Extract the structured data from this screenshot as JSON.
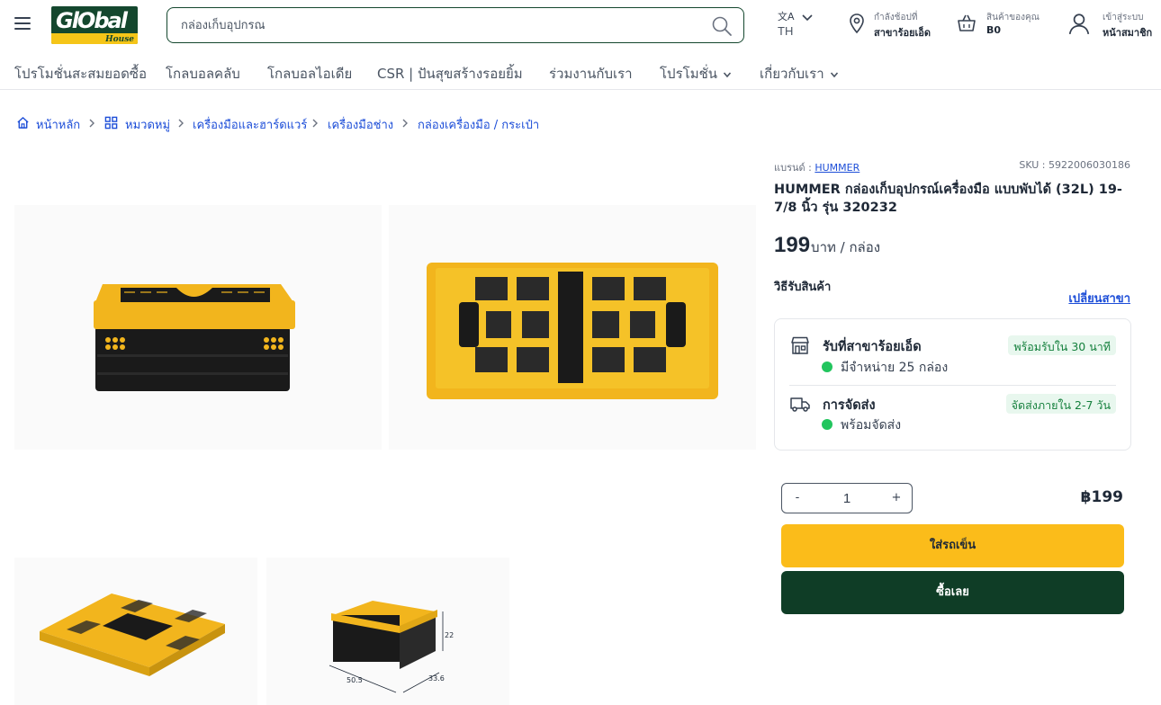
{
  "header": {
    "logo_text": "GlObal",
    "logo_sub": "House",
    "search_placeholder": "กล่องเก็บอุปกรณ",
    "lang_glyph": "文A",
    "lang_code": "TH",
    "branch": {
      "top": "กำลังช้อปที่",
      "bottom": "สาขาร้อยเอ็ด"
    },
    "cart": {
      "top": "สินค้าของคุณ",
      "bottom": "B0"
    },
    "account": {
      "top": "เข้าสู่ระบบ",
      "bottom": "หน้าสมาชิก"
    }
  },
  "nav": {
    "items": [
      {
        "label": "โปรโมชั่นสะสมยอดซื้อ"
      },
      {
        "label": "โกลบอลคลับ"
      },
      {
        "label": "โกลบอลไอเดีย"
      },
      {
        "label": "CSR | ปันสุขสร้างรอยยิ้ม"
      },
      {
        "label": "ร่วมงานกับเรา"
      },
      {
        "label": "โปรโมชั่น"
      },
      {
        "label": "เกี่ยวกับเรา"
      }
    ]
  },
  "breadcrumb": {
    "items": [
      {
        "label": "หน้าหลัก"
      },
      {
        "label": "หมวดหมู่"
      },
      {
        "label": "เครื่องมือและฮาร์ดแวร์"
      },
      {
        "label": "เครื่องมือช่าง"
      },
      {
        "label": "กล่องเครื่องมือ / กระเป๋า"
      }
    ]
  },
  "images": {
    "dimension_height": "22",
    "dimension_width": "33.6",
    "dimension_length": "50.5"
  },
  "product": {
    "brand_label": "แบรนด์ :",
    "brand": "HUMMER",
    "sku": "SKU : 5922006030186",
    "title": "HUMMER กล่องเก็บอุปกรณ์เครื่องมือ แบบพับได้ (32L) 19-7/8 นิ้ว รุ่น 320232",
    "price": "199",
    "price_unit": "บาท / กล่อง",
    "pickup_label": "วิธีรับสินค้า",
    "change_branch": "เปลี่ยนสาขา"
  },
  "delivery": {
    "store": {
      "title": "รับที่สาขาร้อยเอ็ด",
      "badge": "พร้อมรับใน 30 นาที",
      "status": "มีจำหน่าย 25 กล่อง"
    },
    "ship": {
      "title": "การจัดส่ง",
      "badge": "จัดส่งภายใน 2-7 วัน",
      "status": "พร้อมจัดส่ง"
    }
  },
  "purchase": {
    "minus": "-",
    "plus": "+",
    "quantity": "1",
    "total": "฿199",
    "add_to_cart": "ใส่รถเข็น",
    "buy_now": "ซื้อเลย"
  },
  "colors": {
    "brand_green": "#0f3d26",
    "accent_yellow": "#fbbc1a",
    "link_blue": "#1d4ed8",
    "available_green": "#22c55e"
  }
}
